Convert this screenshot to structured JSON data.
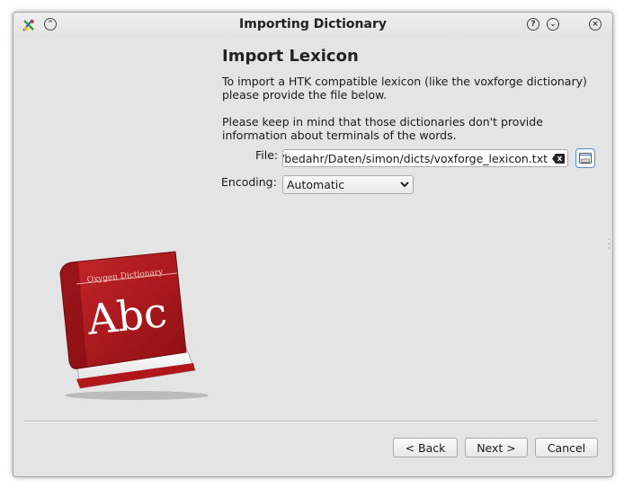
{
  "window": {
    "title": "Importing Dictionary",
    "help_glyph": "?",
    "shade_glyph": "⌄",
    "keep_above_glyph": "⌃",
    "close_glyph": "×"
  },
  "page": {
    "heading": "Import Lexicon",
    "intro": "To import a HTK compatible lexicon (like the voxforge dictionary) please provide the file below.",
    "note": "Please keep in mind that those dictionaries don't provide information about terminals of the words."
  },
  "form": {
    "file_label": "File:",
    "file_value": "/bedahr/Daten/simon/dicts/voxforge_lexicon.txt",
    "encoding_label": "Encoding:",
    "encoding_value": "Automatic"
  },
  "book_illustration": {
    "title": "Oxygen Dictionary",
    "cover_text": "Abc",
    "color": "#b3161b"
  },
  "buttons": {
    "back": "< Back",
    "next": "Next >",
    "cancel": "Cancel"
  },
  "icons": {
    "app": "simon-logo-icon",
    "clear": "clear-text-icon",
    "open": "open-file-icon"
  }
}
